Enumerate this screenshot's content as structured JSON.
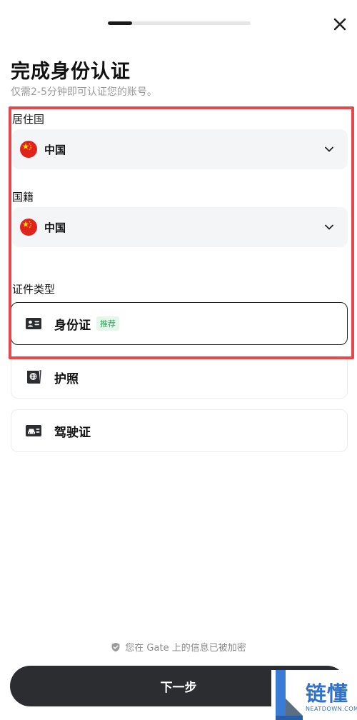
{
  "progress": {
    "fraction": 0.17
  },
  "header": {
    "title": "完成身份认证",
    "subtitle": "仅需2-5分钟即可认证您的账号。"
  },
  "residence": {
    "label": "居住国",
    "value": "中国"
  },
  "nationality": {
    "label": "国籍",
    "value": "中国"
  },
  "document_type": {
    "label": "证件类型",
    "options": [
      {
        "label": "身份证",
        "badge": "推荐",
        "selected": true,
        "icon": "id-card-icon"
      },
      {
        "label": "护照",
        "selected": false,
        "icon": "passport-icon"
      },
      {
        "label": "驾驶证",
        "selected": false,
        "icon": "driver-license-icon"
      }
    ]
  },
  "footer": {
    "secure_text": "您在 Gate 上的信息已被加密",
    "next_label": "下一步"
  },
  "watermark": {
    "title": "链懂",
    "sub": "NEATDOWN.COM"
  },
  "colors": {
    "highlight": "#e84848",
    "button": "#2c2d31",
    "badge_text": "#2aa656",
    "badge_bg": "#e5f6eb",
    "watermark": "#3172c7"
  }
}
